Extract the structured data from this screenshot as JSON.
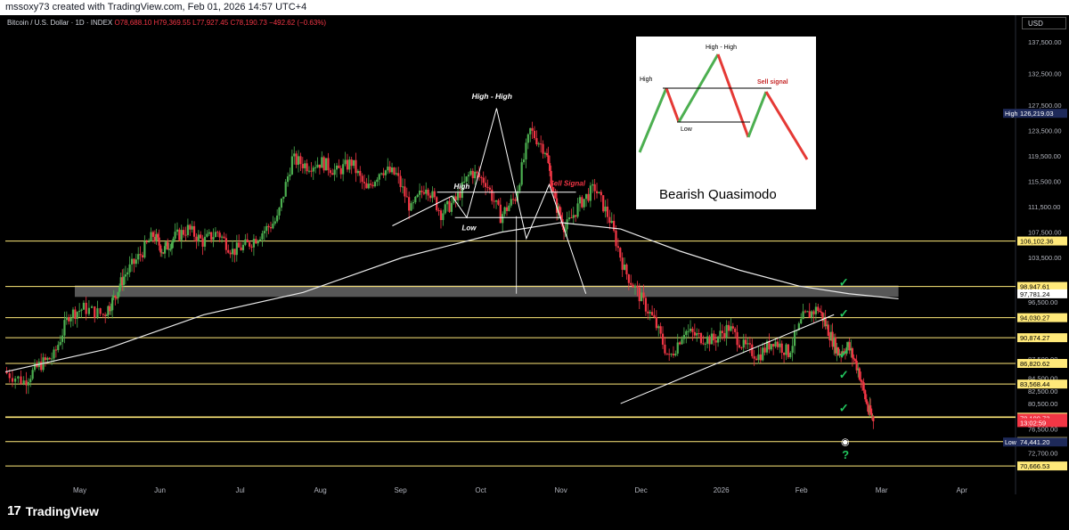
{
  "header": {
    "credit": "mssoxy73 created with TradingView.com, Feb 01, 2026 14:57 UTC+4"
  },
  "legend": {
    "symbol": "Bitcoin / U.S. Dollar · 1D · INDEX",
    "o_label": "O",
    "open": "78,688.10",
    "h_label": "H",
    "high": "79,369.55",
    "l_label": "L",
    "low": "77,927.45",
    "c_label": "C",
    "close": "78,190.73",
    "change": "−492.62 (−0.63%)"
  },
  "currency": "USD",
  "footer": {
    "brand": "TradingView"
  },
  "colors": {
    "up": "#4caf50",
    "down": "#f23645",
    "level": "#f5e663",
    "ma": "#e8e8e8",
    "check": "#22c55e"
  },
  "chart_data": {
    "type": "candlestick",
    "title": "Bitcoin / U.S. Dollar · 1D · INDEX",
    "ylim": [
      69000,
      140000
    ],
    "x_ticks": [
      "May",
      "Jun",
      "Jul",
      "Aug",
      "Sep",
      "Oct",
      "Nov",
      "Dec",
      "2026",
      "Feb",
      "Mar",
      "Apr"
    ],
    "y_ticks": [
      "137,500.00",
      "132,500.00",
      "127,500.00",
      "123,500.00",
      "119,500.00",
      "115,500.00",
      "111,500.00",
      "107,500.00",
      "103,500.00",
      "96,500.00",
      "87,500.00",
      "84,500.00",
      "82,500.00",
      "80,500.00",
      "76,500.00",
      "72,700.00"
    ],
    "horizontal_levels": [
      {
        "value": 106102.36,
        "label": "106,102.36",
        "color": "#ffe97a"
      },
      {
        "value": 98947.61,
        "label": "98,947.61",
        "color": "#ffe97a"
      },
      {
        "value": 94030.27,
        "label": "94,030.27",
        "color": "#ffe97a"
      },
      {
        "value": 90874.27,
        "label": "90,874.27",
        "color": "#ffe97a"
      },
      {
        "value": 86820.62,
        "label": "86,820.62",
        "color": "#ffe97a"
      },
      {
        "value": 83568.44,
        "label": "83,568.44",
        "color": "#ffe97a"
      },
      {
        "value": 78350.57,
        "label": "78,350.57",
        "color": "#ffe97a"
      },
      {
        "value": 74513.4,
        "label": "74,513.40",
        "color": "#ffe97a"
      },
      {
        "value": 70666.53,
        "label": "70,666.53",
        "color": "#ffe97a"
      }
    ],
    "price_tags": [
      {
        "value": 126219.03,
        "label": "126,219.03",
        "prefix": "High",
        "bg": "#1e2a5a",
        "fg": "#ffffff"
      },
      {
        "value": 97781.24,
        "label": "97,781.24",
        "bg": "#ffffff",
        "fg": "#000000"
      },
      {
        "value": 78190.73,
        "label": "78,190.73",
        "bg": "#f23645",
        "fg": "#ffffff"
      },
      {
        "value": 77500,
        "label": "13:02:59",
        "bg": "#f23645",
        "fg": "#ffffff"
      },
      {
        "value": 74441.2,
        "label": "74,441.20",
        "prefix": "Low",
        "bg": "#1e2a5a",
        "fg": "#ffffff"
      }
    ],
    "annotations": {
      "high_high": "High - High",
      "high": "High",
      "low": "Low",
      "sell": "Sell Signal"
    },
    "series": [
      {
        "name": "BTCUSD",
        "points": [
          [
            0.0,
            85500
          ],
          [
            0.02,
            84000
          ],
          [
            0.035,
            86500
          ],
          [
            0.05,
            88000
          ],
          [
            0.065,
            94500
          ],
          [
            0.08,
            95500
          ],
          [
            0.1,
            94500
          ],
          [
            0.11,
            97000
          ],
          [
            0.12,
            100500
          ],
          [
            0.135,
            103500
          ],
          [
            0.15,
            107000
          ],
          [
            0.16,
            104500
          ],
          [
            0.17,
            106500
          ],
          [
            0.185,
            108000
          ],
          [
            0.2,
            106000
          ],
          [
            0.215,
            107500
          ],
          [
            0.23,
            104500
          ],
          [
            0.245,
            105500
          ],
          [
            0.26,
            107500
          ],
          [
            0.275,
            109500
          ],
          [
            0.29,
            119000
          ],
          [
            0.305,
            118000
          ],
          [
            0.32,
            118500
          ],
          [
            0.335,
            117000
          ],
          [
            0.35,
            118500
          ],
          [
            0.365,
            114000
          ],
          [
            0.38,
            117500
          ],
          [
            0.395,
            116500
          ],
          [
            0.41,
            111000
          ],
          [
            0.425,
            115000
          ],
          [
            0.44,
            110500
          ],
          [
            0.455,
            112500
          ],
          [
            0.47,
            117000
          ],
          [
            0.485,
            115500
          ],
          [
            0.5,
            110000
          ],
          [
            0.515,
            113000
          ],
          [
            0.53,
            123500
          ],
          [
            0.545,
            120500
          ],
          [
            0.555,
            112000
          ],
          [
            0.565,
            108000
          ],
          [
            0.58,
            112000
          ],
          [
            0.595,
            114500
          ],
          [
            0.61,
            109500
          ],
          [
            0.625,
            101500
          ],
          [
            0.64,
            97500
          ],
          [
            0.655,
            93500
          ],
          [
            0.67,
            87500
          ],
          [
            0.685,
            92000
          ],
          [
            0.7,
            91000
          ],
          [
            0.715,
            90500
          ],
          [
            0.73,
            92500
          ],
          [
            0.745,
            89500
          ],
          [
            0.76,
            88000
          ],
          [
            0.775,
            90500
          ],
          [
            0.79,
            88500
          ],
          [
            0.805,
            94000
          ],
          [
            0.82,
            95500
          ],
          [
            0.83,
            92000
          ],
          [
            0.84,
            88500
          ],
          [
            0.85,
            89500
          ],
          [
            0.86,
            86000
          ],
          [
            0.87,
            79500
          ],
          [
            0.875,
            78190
          ]
        ]
      },
      {
        "name": "MA200",
        "points": [
          [
            0.0,
            85500
          ],
          [
            0.1,
            89000
          ],
          [
            0.2,
            94500
          ],
          [
            0.3,
            98000
          ],
          [
            0.4,
            103500
          ],
          [
            0.5,
            107500
          ],
          [
            0.56,
            109000
          ],
          [
            0.62,
            108000
          ],
          [
            0.68,
            104500
          ],
          [
            0.74,
            101500
          ],
          [
            0.8,
            99000
          ],
          [
            0.85,
            97800
          ],
          [
            0.9,
            97000
          ]
        ]
      }
    ],
    "inset": {
      "title": "Bearish Quasimodo",
      "labels": [
        "High - High",
        "High",
        "Low",
        "Sell signal"
      ]
    }
  }
}
